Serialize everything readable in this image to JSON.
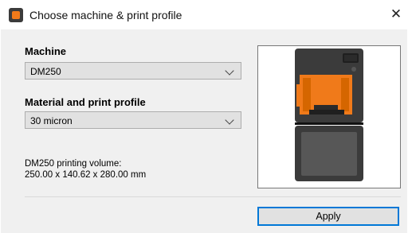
{
  "window": {
    "title": "Choose machine & print profile",
    "close_symbol": "✕"
  },
  "machine": {
    "label": "Machine",
    "selected": "DM250"
  },
  "profile": {
    "label": "Material and print profile",
    "selected": "30 micron"
  },
  "info": {
    "line1": "DM250 printing volume:",
    "line2": "250.00 x 140.62 x 280.00 mm"
  },
  "buttons": {
    "apply": "Apply"
  },
  "colors": {
    "accent": "#0078d7",
    "printer_orange": "#f07a1a",
    "printer_body": "#3b3b3b"
  }
}
